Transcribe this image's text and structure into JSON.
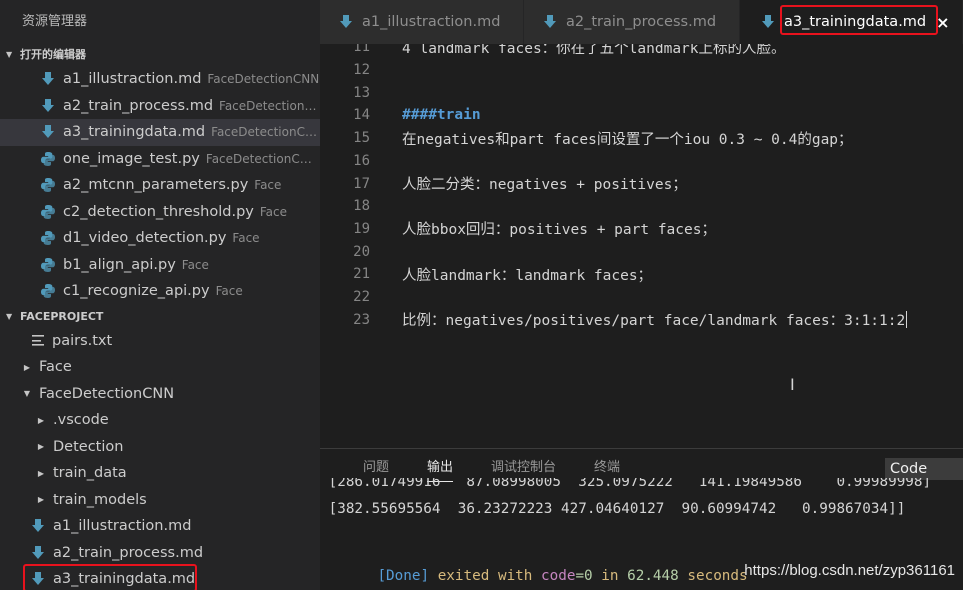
{
  "sidebar": {
    "title": "资源管理器",
    "open_editors": {
      "label": "打开的编辑器",
      "items": [
        {
          "name": "a1_illustraction.md",
          "folder": "FaceDetectionCNN",
          "icon": "download-icon"
        },
        {
          "name": "a2_train_process.md",
          "folder": "FaceDetectionC...",
          "icon": "download-icon"
        },
        {
          "name": "a3_trainingdata.md",
          "folder": "FaceDetectionCN...",
          "icon": "download-icon"
        },
        {
          "name": "one_image_test.py",
          "folder": "FaceDetectionCN...",
          "icon": "python-icon"
        },
        {
          "name": "a2_mtcnn_parameters.py",
          "folder": "Face",
          "icon": "python-icon"
        },
        {
          "name": "c2_detection_threshold.py",
          "folder": "Face",
          "icon": "python-icon"
        },
        {
          "name": "d1_video_detection.py",
          "folder": "Face",
          "icon": "python-icon"
        },
        {
          "name": "b1_align_api.py",
          "folder": "Face",
          "icon": "python-icon"
        },
        {
          "name": "c1_recognize_api.py",
          "folder": "Face",
          "icon": "python-icon"
        }
      ]
    },
    "project": {
      "label": "FACEPROJECT",
      "items": [
        {
          "name": "pairs.txt",
          "icon": "text-file-icon"
        },
        {
          "name": "Face",
          "icon": "chevron-right-icon"
        },
        {
          "name": "FaceDetectionCNN",
          "icon": "chevron-down-icon"
        },
        {
          "name": ".vscode",
          "icon": "chevron-right-icon"
        },
        {
          "name": "Detection",
          "icon": "chevron-right-icon"
        },
        {
          "name": "train_data",
          "icon": "chevron-right-icon"
        },
        {
          "name": "train_models",
          "icon": "chevron-right-icon"
        },
        {
          "name": "a1_illustraction.md",
          "icon": "download-icon"
        },
        {
          "name": "a2_train_process.md",
          "icon": "download-icon"
        },
        {
          "name": "a3_trainingdata.md",
          "icon": "download-icon"
        }
      ]
    }
  },
  "tabs": [
    {
      "label": "a1_illustraction.md"
    },
    {
      "label": "a2_train_process.md"
    },
    {
      "label": "a3_trainingdata.md",
      "close": "×"
    }
  ],
  "editor": {
    "lines": [
      {
        "num": "11",
        "text": "4 landmark faces：你在了五个landmark上标的人脸。"
      },
      {
        "num": "12",
        "text": ""
      },
      {
        "num": "13",
        "text": ""
      },
      {
        "num": "14",
        "text": "####train"
      },
      {
        "num": "15",
        "text": "在negatives和part faces间设置了一个iou 0.3 ~ 0.4的gap；"
      },
      {
        "num": "16",
        "text": ""
      },
      {
        "num": "17",
        "text": "人脸二分类：negatives + positives；"
      },
      {
        "num": "18",
        "text": ""
      },
      {
        "num": "19",
        "text": "人脸bbox回归：positives + part faces；"
      },
      {
        "num": "20",
        "text": ""
      },
      {
        "num": "21",
        "text": "人脸landmark：landmark faces；"
      },
      {
        "num": "22",
        "text": ""
      },
      {
        "num": "23",
        "text": "比例：negatives/positives/part face/landmark faces：3:1:1:2"
      }
    ],
    "mouse_cursor": "I"
  },
  "panel": {
    "tabs": [
      "问题",
      "输出",
      "调试控制台",
      "终端"
    ],
    "active_tab": "输出",
    "select_value": "Code",
    "output": {
      "partial_line": " [286.01749916   87.08998005  325.0975222   141.19849586    0.99989998]",
      "row": " [382.55695564  36.23272223 427.04640127  90.60994742   0.99867034]]",
      "done": "[Done]",
      "exited": " exited ",
      "with": "with ",
      "code": "code",
      "code_value": "=0",
      "in": " in ",
      "seconds_value": "62.448",
      "seconds": " seconds"
    },
    "colors": {
      "done": "#569cd6",
      "exited": "#d7ba7d",
      "keyword": "#c586c0",
      "number": "#b5cea8"
    }
  },
  "watermark": "https://blog.csdn.net/zyp361161",
  "colors": {
    "highlight": "#e8121d",
    "md_icon": "#519aba",
    "python_icon": "#519aba"
  }
}
